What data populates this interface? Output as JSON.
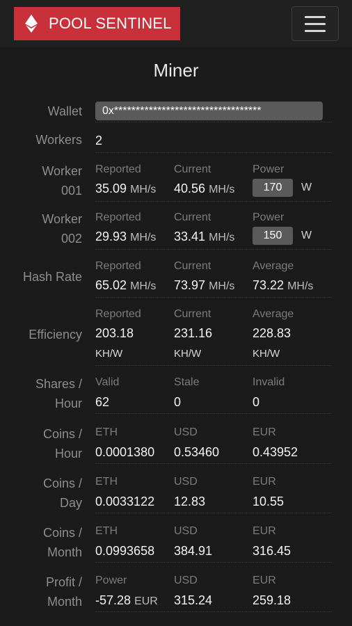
{
  "header": {
    "brand": "POOL SENTINEL",
    "icon": "ethereum-diamond-icon",
    "menu_icon": "hamburger-menu-icon",
    "brand_color": "#c8303a"
  },
  "title": "Miner",
  "wallet": {
    "label": "Wallet",
    "value": "0x**********************************"
  },
  "workers": {
    "label": "Workers",
    "value": "2"
  },
  "worker_001": {
    "label1": "Worker",
    "label2": "001",
    "h1": "Reported",
    "h2": "Current",
    "h3": "Power",
    "reported": "35.09",
    "current": "40.56",
    "unit": "MH/s",
    "power": "170",
    "power_unit": "W"
  },
  "worker_002": {
    "label1": "Worker",
    "label2": "002",
    "h1": "Reported",
    "h2": "Current",
    "h3": "Power",
    "reported": "29.93",
    "current": "33.41",
    "unit": "MH/s",
    "power": "150",
    "power_unit": "W"
  },
  "hash_rate": {
    "label": "Hash Rate",
    "h1": "Reported",
    "h2": "Current",
    "h3": "Average",
    "v1": "65.02",
    "v2": "73.97",
    "v3": "73.22",
    "unit": "MH/s"
  },
  "efficiency": {
    "label": "Efficiency",
    "h1": "Reported",
    "h2": "Current",
    "h3": "Average",
    "v1": "203.18",
    "v2": "231.16",
    "v3": "228.83",
    "unit": "KH/W"
  },
  "shares_hour": {
    "label1": "Shares /",
    "label2": "Hour",
    "h1": "Valid",
    "h2": "Stale",
    "h3": "Invalid",
    "v1": "62",
    "v2": "0",
    "v3": "0"
  },
  "coins_hour": {
    "label1": "Coins /",
    "label2": "Hour",
    "h1": "ETH",
    "h2": "USD",
    "h3": "EUR",
    "v1": "0.0001380",
    "v2": "0.53460",
    "v3": "0.43952"
  },
  "coins_day": {
    "label1": "Coins /",
    "label2": "Day",
    "h1": "ETH",
    "h2": "USD",
    "h3": "EUR",
    "v1": "0.0033122",
    "v2": "12.83",
    "v3": "10.55"
  },
  "coins_month": {
    "label1": "Coins /",
    "label2": "Month",
    "h1": "ETH",
    "h2": "USD",
    "h3": "EUR",
    "v1": "0.0993658",
    "v2": "384.91",
    "v3": "316.45"
  },
  "profit_month": {
    "label1": "Profit /",
    "label2": "Month",
    "h1": "Power",
    "h2": "USD",
    "h3": "EUR",
    "v1": "-57.28",
    "v1_unit": "EUR",
    "v2": "315.24",
    "v3": "259.18"
  }
}
